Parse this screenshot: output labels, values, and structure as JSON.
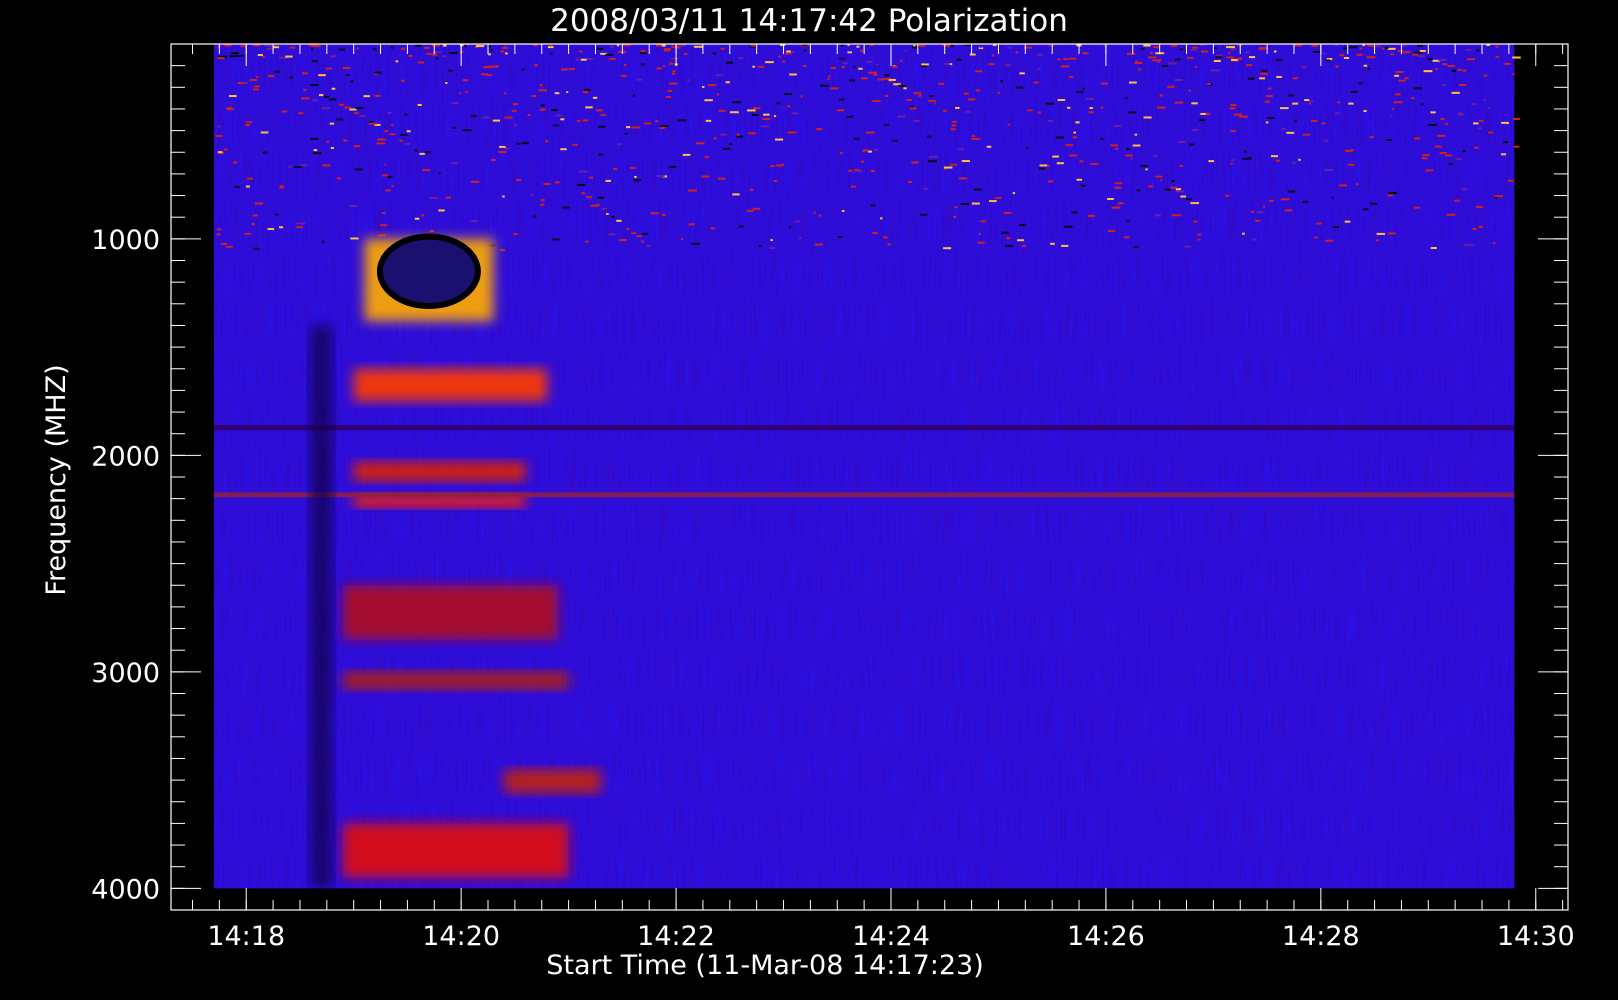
{
  "chart_data": {
    "type": "heatmap",
    "title": "2008/03/11 14:17:42 Polarization",
    "xlabel": "Start Time (11-Mar-08 14:17:23)",
    "ylabel": "Frequency (MHZ)",
    "x_ticks": [
      {
        "value": 18,
        "label": "14:18"
      },
      {
        "value": 20,
        "label": "14:20"
      },
      {
        "value": 22,
        "label": "14:22"
      },
      {
        "value": 24,
        "label": "14:24"
      },
      {
        "value": 26,
        "label": "14:26"
      },
      {
        "value": 28,
        "label": "14:28"
      },
      {
        "value": 30,
        "label": "14:30"
      }
    ],
    "y_ticks": [
      {
        "value": 1000,
        "label": "1000"
      },
      {
        "value": 2000,
        "label": "2000"
      },
      {
        "value": 3000,
        "label": "3000"
      },
      {
        "value": 4000,
        "label": "4000"
      }
    ],
    "xlim": [
      17.3,
      30.3
    ],
    "ylim": [
      100,
      4100
    ],
    "data_extent": {
      "t_start": 17.7,
      "t_end": 29.8,
      "f_low": 100,
      "f_high": 4000
    },
    "features": [
      {
        "kind": "burst",
        "t0": 19.1,
        "t1": 20.3,
        "f0": 1000,
        "f1": 1380,
        "color": "#ffaa00"
      },
      {
        "kind": "burst",
        "t0": 19.0,
        "t1": 20.8,
        "f0": 1600,
        "f1": 1750,
        "color": "#ff3a00"
      },
      {
        "kind": "burst",
        "t0": 19.0,
        "t1": 20.6,
        "f0": 2030,
        "f1": 2120,
        "color": "#e02000"
      },
      {
        "kind": "burst",
        "t0": 19.0,
        "t1": 20.6,
        "f0": 2180,
        "f1": 2240,
        "color": "#ff2000"
      },
      {
        "kind": "burst",
        "t0": 18.9,
        "t1": 20.9,
        "f0": 2600,
        "f1": 2850,
        "color": "#b01020"
      },
      {
        "kind": "burst",
        "t0": 18.9,
        "t1": 21.0,
        "f0": 3000,
        "f1": 3080,
        "color": "#b02010"
      },
      {
        "kind": "burst",
        "t0": 20.4,
        "t1": 21.3,
        "f0": 3450,
        "f1": 3560,
        "color": "#c02010"
      },
      {
        "kind": "burst",
        "t0": 18.9,
        "t1": 21.0,
        "f0": 3700,
        "f1": 3950,
        "color": "#e01010"
      },
      {
        "kind": "line",
        "t0": 17.7,
        "t1": 29.8,
        "f": 1870,
        "color": "#300060"
      },
      {
        "kind": "line",
        "t0": 17.7,
        "t1": 29.8,
        "f": 2180,
        "color": "#902040"
      },
      {
        "kind": "dip",
        "t0": 18.6,
        "t1": 18.8,
        "f0": 1400,
        "f1": 4000,
        "color": "#100040"
      }
    ],
    "colors": {
      "background": "#000000",
      "plot_base": "#2a10e8",
      "axes": "#ffffff"
    }
  }
}
